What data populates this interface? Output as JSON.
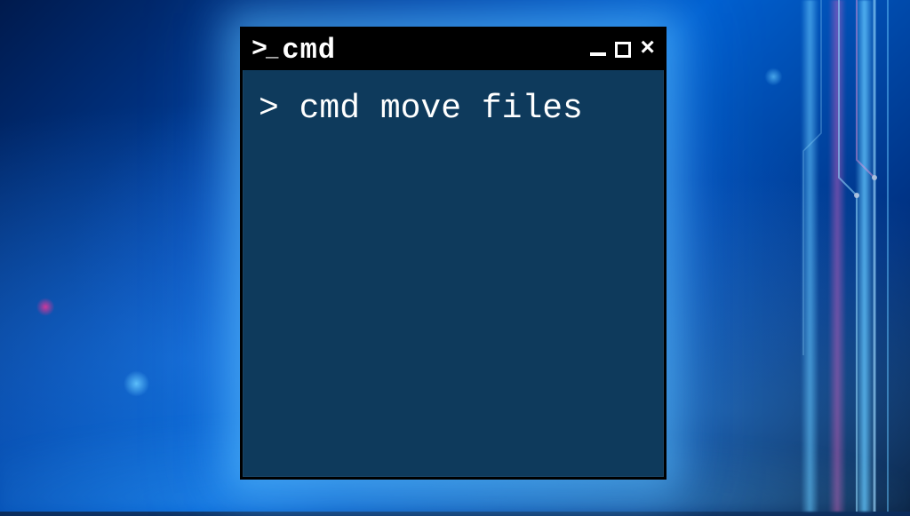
{
  "window": {
    "title": "cmd",
    "icon_label": ">_"
  },
  "terminal": {
    "prompt": ">",
    "command": "cmd move files"
  },
  "colors": {
    "terminal_bg": "#0e3a5c",
    "titlebar_bg": "#000000",
    "text": "#ffffff",
    "glow": "#64c8ff"
  }
}
